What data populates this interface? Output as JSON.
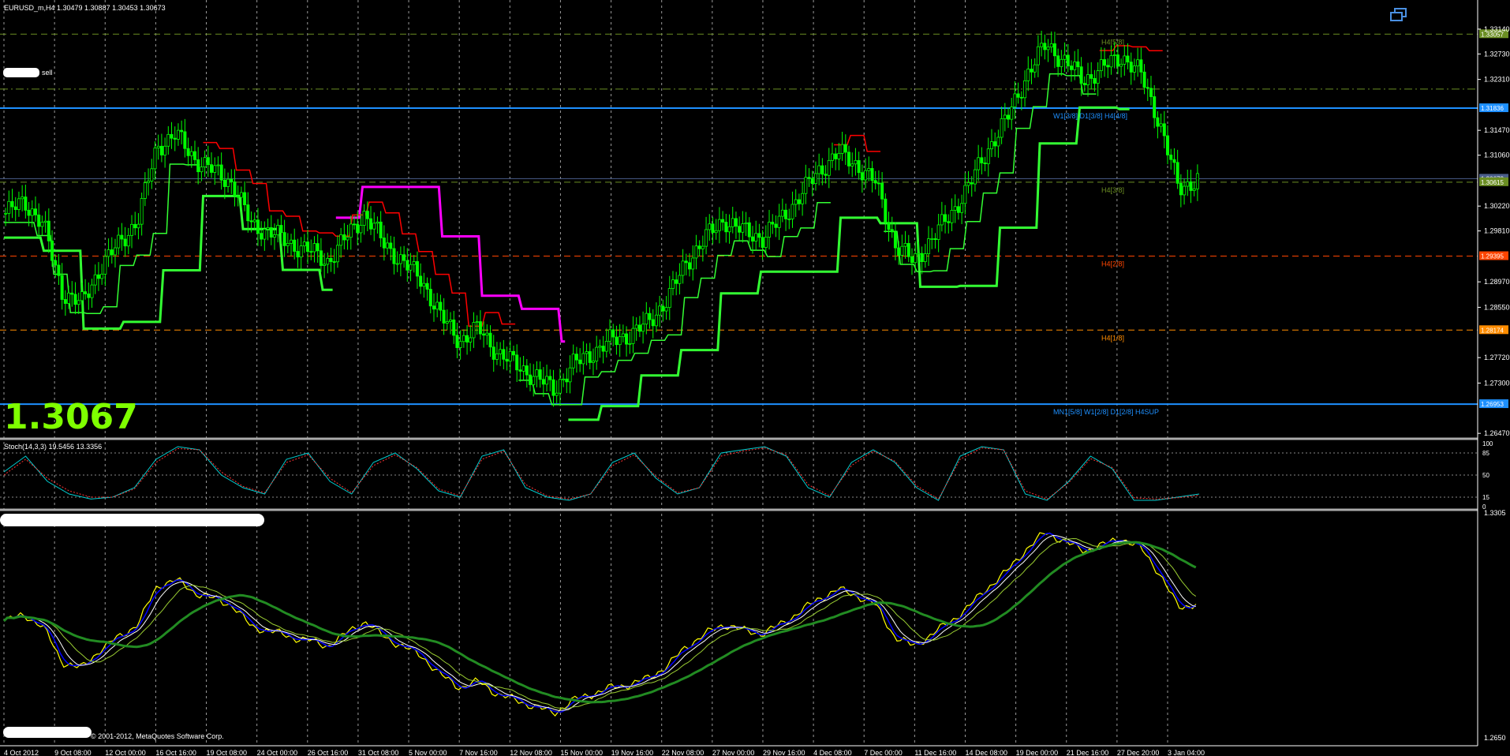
{
  "header": {
    "symbol_line": "EURUSD_m,H4  1.30479 1.30887 1.30453 1.30673",
    "sell_label": "sell",
    "big_price": "1.3067",
    "copyright": "© 2001-2012, MetaQuotes Software Corp."
  },
  "icons": {
    "restore": "window-restore-icon"
  },
  "colors": {
    "background": "#000000",
    "candle": "#00ff00",
    "blue_level": "#1e90ff",
    "olive_level": "#6b8e23",
    "red_level": "#ff4500",
    "orange_level": "#ff8c00",
    "trail_green": "#33ff33",
    "trail_red": "#ff0000",
    "trail_magenta": "#ff00ff"
  },
  "chart_data": [
    {
      "type": "candlestick",
      "panel": "main",
      "title": "EURUSD_m,H4",
      "ylim": [
        1.2642,
        1.3336
      ],
      "x_ticks": [
        "4 Oct 2012",
        "9 Oct 08:00",
        "12 Oct 00:00",
        "16 Oct 16:00",
        "19 Oct 08:00",
        "24 Oct 00:00",
        "26 Oct 16:00",
        "31 Oct 08:00",
        "5 Nov 00:00",
        "7 Nov 16:00",
        "12 Nov 08:00",
        "15 Nov 00:00",
        "19 Nov 16:00",
        "22 Nov 08:00",
        "27 Nov 00:00",
        "29 Nov 16:00",
        "4 Dec 08:00",
        "7 Dec 00:00",
        "11 Dec 16:00",
        "14 Dec 08:00",
        "19 Dec 00:00",
        "21 Dec 16:00",
        "27 Dec 20:00",
        "3 Jan 04:00"
      ],
      "y_ticks": [
        1.3314,
        1.3273,
        1.3231,
        1.3147,
        1.3106,
        1.3022,
        1.2981,
        1.2897,
        1.2855,
        1.2772,
        1.273,
        1.2647
      ],
      "close_path": [
        1.301,
        1.303,
        1.299,
        1.288,
        1.286,
        1.292,
        1.296,
        1.3,
        1.312,
        1.314,
        1.31,
        1.308,
        1.306,
        1.299,
        1.298,
        1.296,
        1.295,
        1.293,
        1.297,
        1.301,
        1.296,
        1.293,
        1.29,
        1.284,
        1.28,
        1.282,
        1.278,
        1.276,
        1.274,
        1.272,
        1.276,
        1.278,
        1.28,
        1.281,
        1.283,
        1.287,
        1.293,
        1.297,
        1.3,
        1.298,
        1.297,
        1.3,
        1.304,
        1.308,
        1.311,
        1.309,
        1.306,
        1.296,
        1.293,
        1.297,
        1.301,
        1.306,
        1.312,
        1.317,
        1.324,
        1.329,
        1.326,
        1.323,
        1.325,
        1.327,
        1.324,
        1.316,
        1.305,
        1.3067
      ],
      "levels": [
        {
          "value": 1.33057,
          "label": "H4[5/8]",
          "price_tag": "1.33057",
          "color": "#6b8e23",
          "style": "dash"
        },
        {
          "value": 1.3215,
          "label": "",
          "price_tag": "",
          "color": "#6b8e23",
          "style": "dashdot"
        },
        {
          "value": 1.31836,
          "label": "W1[3/8] D1[3/8] H4[4/8]",
          "price_tag": "1.31836",
          "color": "#1e90ff",
          "style": "solid"
        },
        {
          "value": 1.30673,
          "label": "",
          "price_tag": "1.30673",
          "color": "#4a5d8a",
          "style": "solid"
        },
        {
          "value": 1.30615,
          "label": "H4[3/8]",
          "price_tag": "1.30615",
          "color": "#6b8e23",
          "style": "dash"
        },
        {
          "value": 1.29395,
          "label": "H4[2/8]",
          "price_tag": "1.29395",
          "color": "#ff4500",
          "style": "dash"
        },
        {
          "value": 1.28174,
          "label": "H4[1/8]",
          "price_tag": "1.28174",
          "color": "#ff8c00",
          "style": "dash"
        },
        {
          "value": 1.26953,
          "label": "MN1[5/8] W1[2/8] D1[2/8] H4SUP",
          "price_tag": "1.26953",
          "color": "#1e90ff",
          "style": "solid"
        }
      ]
    },
    {
      "type": "line",
      "panel": "stochastic",
      "title": "Stoch(14,3,3) 19.5456 13.3356",
      "ylim": [
        0,
        100
      ],
      "y_ticks": [
        100,
        85,
        50,
        15,
        0
      ],
      "series": [
        {
          "name": "Main",
          "values": [
            55,
            80,
            40,
            20,
            12,
            15,
            30,
            75,
            95,
            90,
            50,
            30,
            20,
            75,
            85,
            40,
            20,
            70,
            85,
            60,
            25,
            15,
            80,
            90,
            30,
            15,
            10,
            20,
            70,
            85,
            45,
            20,
            30,
            85,
            90,
            95,
            80,
            30,
            15,
            70,
            90,
            70,
            30,
            10,
            80,
            95,
            90,
            20,
            10,
            40,
            80,
            60,
            10,
            10,
            15,
            20
          ]
        },
        {
          "name": "Signal",
          "values": [
            50,
            75,
            45,
            25,
            15,
            15,
            28,
            70,
            92,
            90,
            55,
            32,
            22,
            70,
            82,
            45,
            22,
            65,
            82,
            62,
            28,
            17,
            75,
            88,
            35,
            17,
            12,
            20,
            65,
            82,
            48,
            22,
            30,
            80,
            88,
            93,
            82,
            35,
            17,
            65,
            88,
            72,
            33,
            12,
            75,
            93,
            90,
            25,
            12,
            38,
            76,
            62,
            14,
            12,
            14,
            18
          ]
        }
      ]
    },
    {
      "type": "line",
      "panel": "moving-averages",
      "ylim": [
        1.265,
        1.3305
      ],
      "y_ticks": [
        1.3305,
        1.265
      ]
    }
  ]
}
